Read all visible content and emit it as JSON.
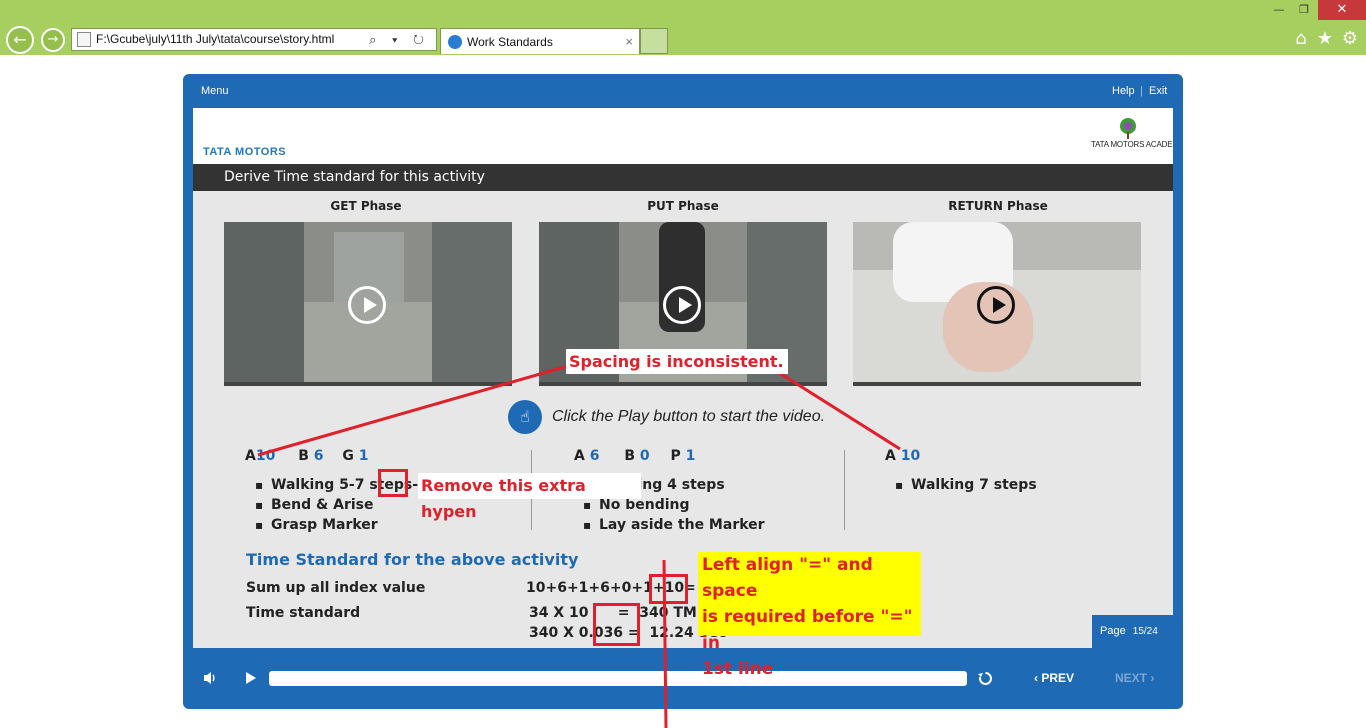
{
  "browser": {
    "address": "F:\\Gcube\\july\\11th July\\tata\\course\\story.html",
    "tab_title": "Work Standards",
    "tab_close": "×",
    "address_tools": "⌕ ▾ ↻",
    "back_glyph": "←",
    "forward_glyph": "→",
    "minimize": "—",
    "maximize": "❐",
    "close": "✕",
    "home_glyph": "⌂",
    "fav_glyph": "★",
    "settings_glyph": "⚙"
  },
  "player": {
    "menu": "Menu",
    "help": "Help",
    "separator": "|",
    "exit": "Exit",
    "prev": "‹ PREV",
    "next": "NEXT ›"
  },
  "slide": {
    "logo": "TATA MOTORS",
    "academy": "TATA MOTORS ACADEMY",
    "title": "Derive Time standard for this activity",
    "phases": [
      "GET Phase",
      "PUT Phase",
      "RETURN Phase"
    ],
    "click_hint": "Click the Play button to start the video.",
    "get": {
      "a": "A",
      "a_val": "10",
      "b": "B",
      "b_val": "6",
      "g": "G",
      "g_val": "1",
      "bullets": [
        "Walking 5-7 steps-",
        "Bend & Arise",
        "Grasp Marker"
      ]
    },
    "put": {
      "a": "A",
      "a_val": "6",
      "b": "B",
      "b_val": "0",
      "p": "P",
      "p_val": "1",
      "bullets": [
        "Walking 4 steps",
        "No bending",
        "Lay aside the Marker"
      ]
    },
    "return": {
      "a": "A",
      "a_val": "10",
      "bullets": [
        "Walking 7 steps"
      ]
    },
    "ts_title": "Time Standard for the above activity",
    "sum_label": "Sum up all index value",
    "sum_expr": "10+6+1+6+0+1+10= 34",
    "time_label": "Time standard",
    "time_line1": "34 X 10      =  340 TMU (T",
    "time_line2": "340 X 0.036 =  12.24 Sec",
    "page_label": "Page",
    "page_num": "15/24"
  },
  "annotations": {
    "spacing": "Spacing is inconsistent.",
    "hyphen": "Remove this extra hypen",
    "align_1": "Left align \"=\" and space",
    "align_2": "is required before \"=\" in",
    "align_3": "1st line"
  },
  "colors": {
    "chrome": "#a7cf5f",
    "player_blue": "#1f6ab4",
    "annotation_red": "#e0202a",
    "annotation_yellow": "#ffff00"
  }
}
